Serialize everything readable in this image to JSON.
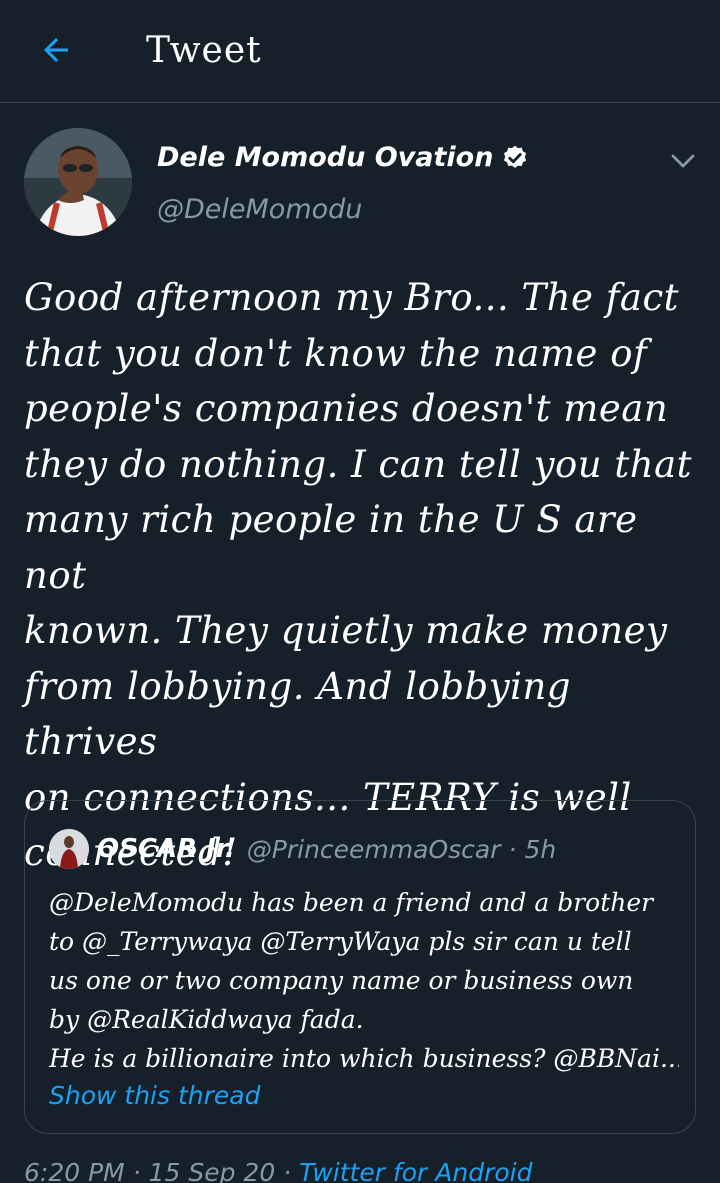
{
  "header": {
    "title": "Tweet",
    "back_icon": "arrow-left-icon",
    "accent_color": "#1da1f2"
  },
  "author": {
    "display_name": "Dele Momodu Ovation",
    "handle": "@DeleMomodu",
    "verified_icon": "verified-badge-icon",
    "menu_icon": "chevron-down-icon"
  },
  "tweet": {
    "lines": [
      "Good afternoon my Bro... The fact",
      "that you don't know the name of",
      "people's companies doesn't mean",
      "they do nothing. I can tell you that",
      "many rich people in the U S are not",
      "known. They quietly make money",
      "from lobbying. And lobbying thrives",
      "on connections... TERRY is well",
      "connected!"
    ]
  },
  "quote": {
    "name": "OSCAR Jr.",
    "handle": "@PrinceemmaOscar",
    "dot": "·",
    "time": "5h",
    "lines": [
      "@DeleMomodu has been a friend and a brother",
      "to @_Terrywaya @TerryWaya pls sir can u tell",
      "us one or two company name or business own",
      "by @RealKiddwaya fada.",
      "He is a billionaire into which business? @BBNai..."
    ],
    "show_thread": "Show this thread"
  },
  "meta": {
    "time": "6:20 PM",
    "sep": "·",
    "date": "15 Sep 20",
    "source": "Twitter for Android"
  }
}
